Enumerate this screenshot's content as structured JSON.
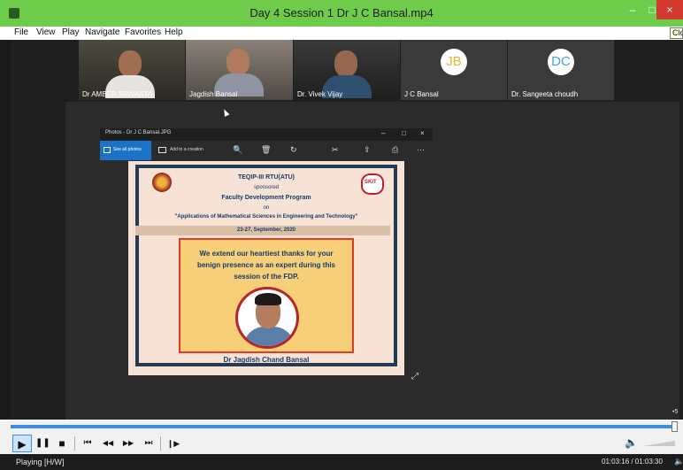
{
  "window": {
    "title": "Day 4 Session 1 Dr J C Bansal.mp4",
    "minimize_glyph": "–",
    "maximize_glyph": "□",
    "close_glyph": "×"
  },
  "menu": [
    "File",
    "View",
    "Play",
    "Navigate",
    "Favorites",
    "Help"
  ],
  "menu_tooltip": "Clo",
  "participants": [
    {
      "name": "Dr AMBER SRIVASTA",
      "type": "video"
    },
    {
      "name": "Jagdish Bansal",
      "type": "video"
    },
    {
      "name": "Dr. Vivek Vijay",
      "type": "video"
    },
    {
      "name": "J C Bansal",
      "type": "avatar",
      "initials": "JB",
      "color": "#e8b43a"
    },
    {
      "name": "Dr. Sangeeta choudh",
      "type": "avatar",
      "initials": "DC",
      "color": "#49a4d8"
    }
  ],
  "photos_window": {
    "title": "Photos - Dr J C Bansal.JPG",
    "see_all": "See all photos",
    "add_to_creation": "Add to a creation",
    "btn_min": "–",
    "btn_max": "□",
    "btn_close": "×",
    "icons": {
      "zoom": "🔍",
      "delete": "🗑",
      "rotate": "↻",
      "edit": "✂",
      "share": "⇪",
      "print": "⎙",
      "more": "···"
    },
    "expand": "⤢"
  },
  "certificate": {
    "line1": "TEQIP-III RTU(ATU)",
    "line2": "sponsored",
    "line3": "Faculty Development Program",
    "line4": "on",
    "line5": "\"Applications of Mathematical Sciences in Engineering and Technology\"",
    "date": "23-27, September, 2020",
    "thanks1": "We extend our heartiest thanks for your",
    "thanks2": "benign presence as an expert during this",
    "thanks3": "session of the FDP.",
    "name": "Dr Jagdish Chand Bansal",
    "logo_right": "SKIT"
  },
  "player": {
    "progress": 0.9995,
    "speed": "•5",
    "buttons": {
      "play": "▶",
      "pause": "❚❚",
      "stop": "■",
      "prev": "⏮",
      "rewind": "◀◀",
      "forward": "▶▶",
      "next": "⏭",
      "frame": "❙▶"
    },
    "volume_icon": "🔈",
    "status": "Playing [H/W]",
    "time": "01:03:16 / 01:03:30",
    "status_volume": "🔈"
  },
  "colors": {
    "titlebar": "#6fcb4a",
    "accent": "#3c8fe0",
    "close": "#d33a2e"
  }
}
